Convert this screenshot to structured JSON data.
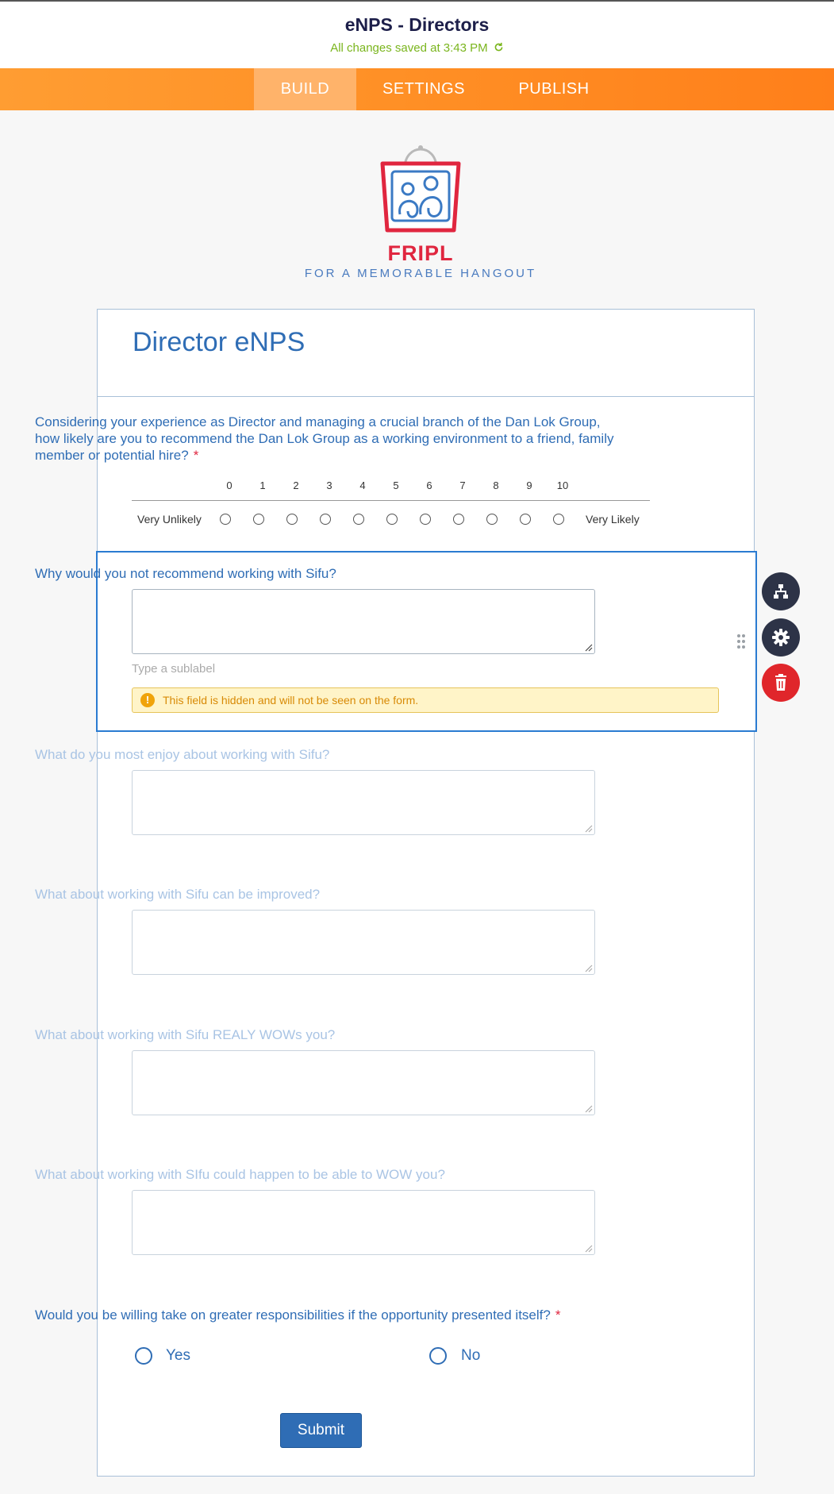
{
  "header": {
    "form_title": "eNPS - Directors",
    "save_status": "All changes saved at 3:43 PM"
  },
  "nav": {
    "tabs": [
      {
        "label": "BUILD",
        "active": true
      },
      {
        "label": "SETTINGS",
        "active": false
      },
      {
        "label": "PUBLISH",
        "active": false
      }
    ]
  },
  "logo": {
    "brand": "FRIPL",
    "tagline": "FOR A MEMORABLE HANGOUT"
  },
  "form": {
    "heading": "Director eNPS",
    "nps_question": {
      "label": "Considering your experience as Director and managing a crucial branch of the Dan Lok Group, how likely are you to recommend the Dan Lok Group as a working environment to a friend, family member or potential hire?",
      "required_mark": "*",
      "scale": [
        "0",
        "1",
        "2",
        "3",
        "4",
        "5",
        "6",
        "7",
        "8",
        "9",
        "10"
      ],
      "low_label": "Very Unlikely",
      "high_label": "Very Likely"
    },
    "selected_question": {
      "label": "Why would you not recommend working with Sifu?",
      "sublabel_placeholder": "Type a sublabel",
      "hidden_notice": "This field is hidden and will not be seen on the form."
    },
    "hidden_questions": [
      {
        "label": "What do you most enjoy about working with Sifu?"
      },
      {
        "label": "What about working with Sifu can be improved?"
      },
      {
        "label": "What about working with Sifu REALY WOWs you?"
      },
      {
        "label": "What about working with SIfu could happen to be able to WOW you?"
      }
    ],
    "responsibility_question": {
      "label": "Would you be willing take on greater responsibilities if the opportunity presented itself?",
      "required_mark": "*",
      "options": [
        "Yes",
        "No"
      ]
    },
    "submit_label": "Submit"
  },
  "colors": {
    "accent": "#ff8f25",
    "primary": "#2f6db5",
    "saved": "#7ab51d",
    "delete": "#e0262b",
    "tool_button": "#2d3347"
  },
  "field_tools": [
    "conditions-icon",
    "settings-gear-icon",
    "delete-trash-icon",
    "drag-handle-icon"
  ]
}
